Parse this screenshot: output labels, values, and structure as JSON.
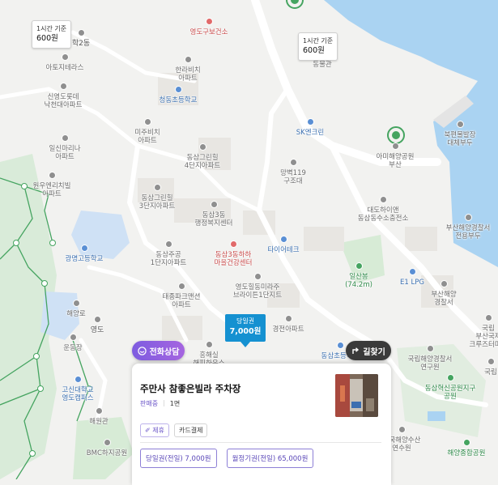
{
  "map": {
    "colors": {
      "land": "#f2f2f0",
      "sea": "#aad3f2",
      "park": "#cfe8cf",
      "road": "#ffffff",
      "trail": "#45a460",
      "block": "#e8e6e2"
    },
    "labels": [
      {
        "text": "영도구보건소",
        "cls": "red"
      },
      {
        "text": "학2동",
        "cls": "dark"
      },
      {
        "text": "아토지테라스",
        "cls": ""
      },
      {
        "text": "한라비치\n아파트",
        "cls": ""
      },
      {
        "text": "신영도롯데\n낙천대아파트",
        "cls": ""
      },
      {
        "text": "청동초등학교",
        "cls": "blue"
      },
      {
        "text": "미주비치\n아파트",
        "cls": ""
      },
      {
        "text": "일신마리나\n아파트",
        "cls": ""
      },
      {
        "text": "원우엔리치빌\n아파트",
        "cls": ""
      },
      {
        "text": "동삼그린힐\n4단지아파트",
        "cls": ""
      },
      {
        "text": "동삼그린힐\n3단지아파트",
        "cls": ""
      },
      {
        "text": "동삼3동\n행정복지센터",
        "cls": ""
      },
      {
        "text": "광명고등학교",
        "cls": "blue"
      },
      {
        "text": "동삼주공\n1단지아파트",
        "cls": ""
      },
      {
        "text": "동삼3동하하\n마을건강센터",
        "cls": "red"
      },
      {
        "text": "태종파크맨션\n아파트",
        "cls": ""
      },
      {
        "text": "영도힐동미라주\n브라이튼1단지트",
        "cls": ""
      },
      {
        "text": "경전아파트",
        "cls": ""
      },
      {
        "text": "흥해실\n해피하우스",
        "cls": ""
      },
      {
        "text": "동삼초등학교",
        "cls": "blue"
      },
      {
        "text": "해양로",
        "cls": ""
      },
      {
        "text": "영도",
        "cls": "dark"
      },
      {
        "text": "운동장",
        "cls": ""
      },
      {
        "text": "고신대학교\n영도캠퍼스",
        "cls": "blue"
      },
      {
        "text": "BMC하지공원",
        "cls": ""
      },
      {
        "text": "해원관",
        "cls": ""
      },
      {
        "text": "SK엔크린",
        "cls": "blue"
      },
      {
        "text": "동물관",
        "cls": ""
      },
      {
        "text": "북편물발장\n대체부두",
        "cls": ""
      },
      {
        "text": "아미해양공원\n부산",
        "cls": ""
      },
      {
        "text": "망벽119\n구조대",
        "cls": ""
      },
      {
        "text": "대도하이앤\n동삼동수소충전소",
        "cls": ""
      },
      {
        "text": "부산해양경찰서\n전용부두",
        "cls": ""
      },
      {
        "text": "타이어테크",
        "cls": "blue"
      },
      {
        "text": "일산봉\n(74.2m)",
        "cls": "green"
      },
      {
        "text": "E1 LPG",
        "cls": "blue"
      },
      {
        "text": "부산해양\n경찰서",
        "cls": ""
      },
      {
        "text": "국립해양경찰서\n연구원",
        "cls": ""
      },
      {
        "text": "국립\n부산국제\n크루즈터미널",
        "cls": ""
      },
      {
        "text": "동삼혁신공원지구\n공원",
        "cls": "green"
      },
      {
        "text": "국립",
        "cls": ""
      },
      {
        "text": "한국해양수산\n연수원",
        "cls": ""
      },
      {
        "text": "해양종합공원",
        "cls": "green"
      }
    ],
    "price_tags": [
      {
        "sub": "1시간 기준",
        "value": "600원"
      },
      {
        "sub": "1시간 기준",
        "value": "600원"
      }
    ]
  },
  "marker": {
    "sub": "당일권",
    "value": "7,000원"
  },
  "buttons": {
    "call": "전화상담",
    "route": "길찾기"
  },
  "card": {
    "title": "주만사 참좋은빌라 주차장",
    "meta_key": "판매중",
    "meta_value": "1면",
    "tags": [
      "제휴",
      "카드결제"
    ],
    "prices": [
      "당일권(전일) 7,000원",
      "월정기권(전일) 65,000원"
    ]
  }
}
